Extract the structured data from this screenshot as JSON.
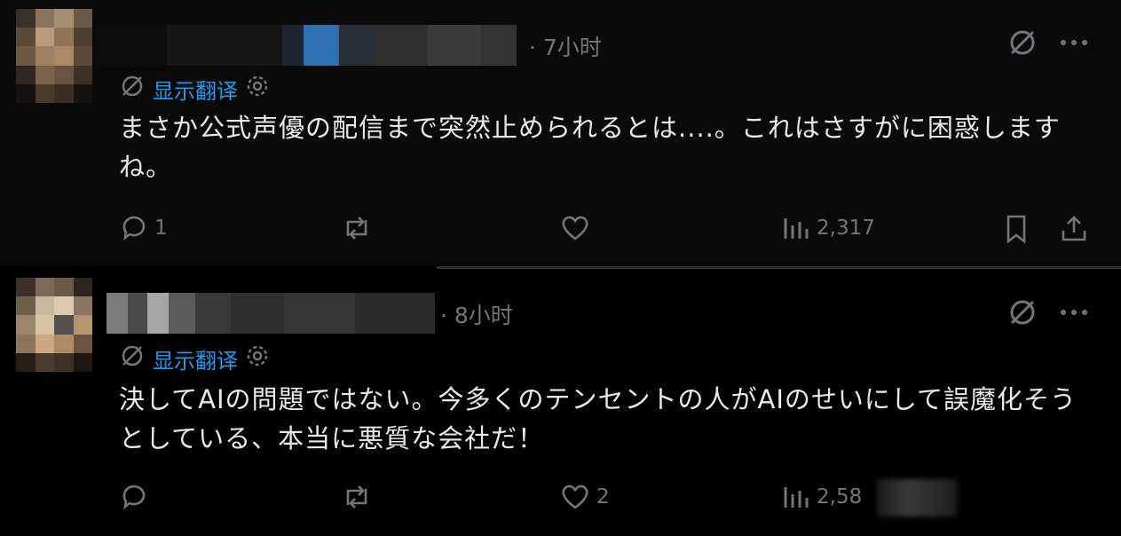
{
  "tweets": [
    {
      "time": "· 7小时",
      "translate_label": "显示翻译",
      "text": "まさか公式声優の配信まで突然止められるとは....。これはさすがに困惑しますね。",
      "replies": "1",
      "retweets": "",
      "likes": "",
      "views": "2,317"
    },
    {
      "time": "· 8小时",
      "translate_label": "显示翻译",
      "text": "決してAIの問題ではない。今多くのテンセントの人がAIのせいにして誤魔化そうとしている、本当に悪質な会社だ！",
      "replies": "",
      "retweets": "",
      "likes": "2",
      "views": "2,58"
    }
  ],
  "icons": {
    "grok": "slashed-circle-icon",
    "more": "ellipsis-icon",
    "translate": "no-translate-icon",
    "settings": "gear-icon",
    "reply": "reply-icon",
    "retweet": "retweet-icon",
    "like": "heart-icon",
    "views": "bar-chart-icon",
    "bookmark": "bookmark-icon",
    "share": "share-icon"
  },
  "colors": {
    "background": "#000000",
    "text": "#e7e9ea",
    "muted": "#71767b",
    "link": "#1d9bf0"
  }
}
